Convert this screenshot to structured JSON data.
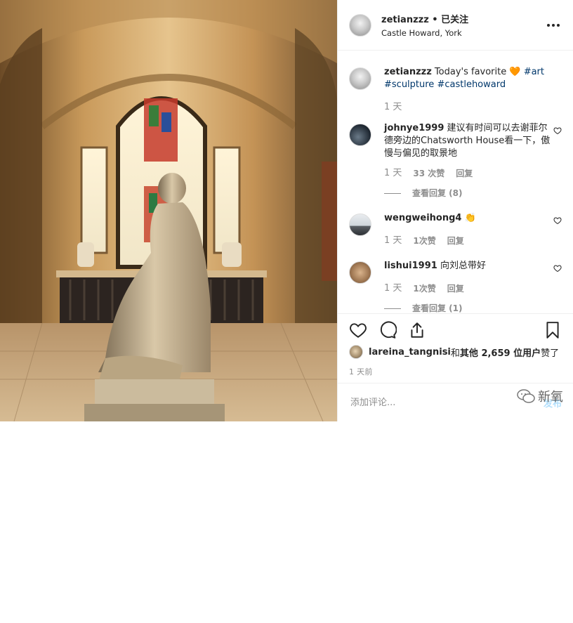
{
  "post": {
    "username": "zetianzzz",
    "follow_status": " • 已关注",
    "location": "Castle Howard, York",
    "caption_text": " Today's favorite ",
    "caption_emoji": "🧡",
    "caption_tags": [
      "#art",
      "#sculpture",
      "#castlehoward"
    ],
    "caption_time": "1 天"
  },
  "comments": [
    {
      "username": "johnye1999",
      "text": " 建议有时间可以去谢菲尔德旁边的Chatsworth House看一下，傲慢与偏见的取景地",
      "time": "1 天",
      "likes": "33 次赞",
      "reply": "回复",
      "view_replies": "查看回复 (8)"
    },
    {
      "username": "wengweihong4",
      "text": " 👏",
      "time": "1 天",
      "likes": "1次赞",
      "reply": "回复"
    },
    {
      "username": "lishui1991",
      "text": " 向刘总带好",
      "time": "1 天",
      "likes": "1次赞",
      "reply": "回复",
      "view_replies": "查看回复 (1)"
    }
  ],
  "likes_line": {
    "user": "lareina_tangnisi",
    "and": " 和 ",
    "others": "其他 2,659 位用户",
    "suffix": " 赞了"
  },
  "posted_time": "1 天前",
  "add_comment": {
    "placeholder": "添加评论...",
    "post_label": "发布"
  },
  "watermark": "新氧",
  "icons": [
    "more-icon",
    "heart-icon",
    "comment-icon",
    "share-icon",
    "bookmark-icon"
  ],
  "colors": {
    "link": "#00376b",
    "muted": "#8e8e8e",
    "heart_orange": "#f06a1f"
  }
}
